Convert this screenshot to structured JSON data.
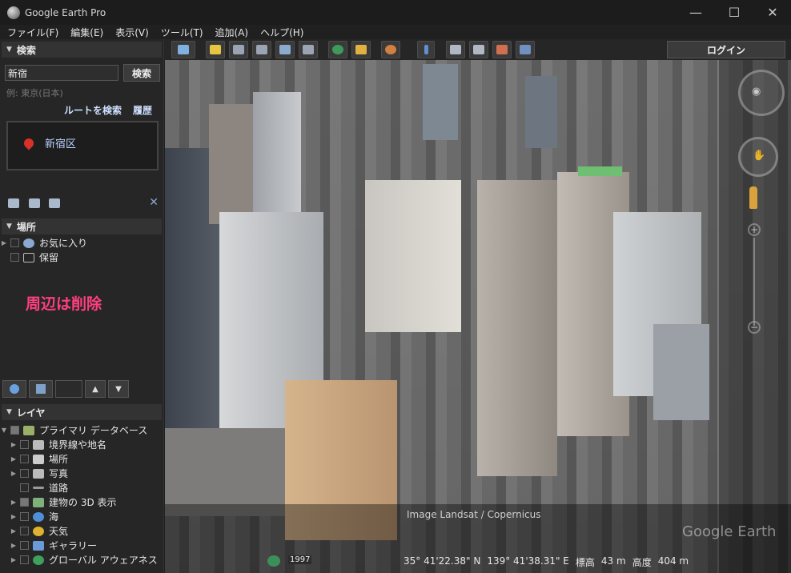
{
  "window": {
    "title": "Google Earth Pro",
    "controls": {
      "minimize": "—",
      "maximize": "☐",
      "close": "✕"
    }
  },
  "menubar": {
    "items": [
      "ファイル(F)",
      "編集(E)",
      "表示(V)",
      "ツール(T)",
      "追加(A)",
      "ヘルプ(H)"
    ]
  },
  "toolbar": {
    "buttons": [
      "sidebar-toggle-icon",
      "placemark-icon",
      "polygon-icon",
      "path-icon",
      "image-overlay-icon",
      "tour-icon",
      "historical-imagery-icon",
      "sunlight-icon",
      "planets-icon",
      "ruler-icon",
      "email-icon",
      "print-icon",
      "save-image-icon",
      "map-view-icon"
    ],
    "login_label": "ログイン"
  },
  "search": {
    "header": "検索",
    "input_value": "新宿",
    "button_label": "検索",
    "hint": "例: 東京(日本)",
    "route_label": "ルートを検索",
    "history_label": "履歴",
    "result_label": "新宿区"
  },
  "places": {
    "header": "場所",
    "items": [
      "お気に入り",
      "保留"
    ]
  },
  "annotation": "周辺は削除",
  "layers": {
    "header": "レイヤ",
    "items": [
      "プライマリ データベース",
      "境界線や地名",
      "場所",
      "写真",
      "道路",
      "建物の 3D 表示",
      "海",
      "天気",
      "ギャラリー",
      "グローバル アウェアネス"
    ]
  },
  "map": {
    "attribution": "Image Landsat / Copernicus",
    "watermark": "Google Earth",
    "year": "1997",
    "status": {
      "lat": "35° 41'22.38\" N",
      "lon": "139° 41'38.31\" E",
      "elev_label": "標高",
      "elev_value": "43 m",
      "alt_label": "高度",
      "alt_value": "404 m"
    }
  },
  "colors": {
    "accent_annotation": "#ff3f7f",
    "pin": "#d9312a",
    "link": "#cfe0ff"
  }
}
